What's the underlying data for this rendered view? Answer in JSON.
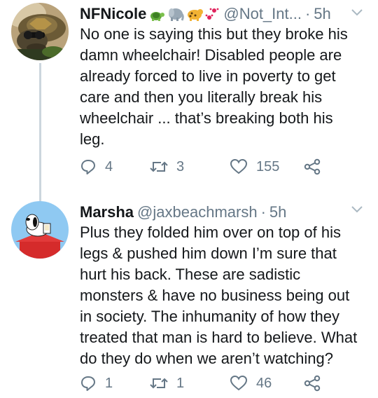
{
  "tweets": [
    {
      "author_name": "NFNicole",
      "author_emojis": [
        "turtle-emoji",
        "elephant-emoji",
        "leopard-emoji",
        "paw-prints-emoji"
      ],
      "handle": "@Not_Int...",
      "separator": "·",
      "time": "5h",
      "body_lines": [
        "No one is saying this but they broke his",
        "damn wheelchair! Disabled people are",
        "already forced to live in poverty to get",
        "care and then you literally break his",
        "wheelchair ... that’s breaking both his",
        "leg."
      ],
      "reply_count": "4",
      "retweet_count": "3",
      "like_count": "155"
    },
    {
      "author_name": "Marsha",
      "handle": "@jaxbeachmarsh",
      "separator": "·",
      "time": "5h",
      "body_lines": [
        "Plus they folded him over on top of his",
        "legs & pushed him down  I’m sure that",
        "hurt his back. These are sadistic",
        "monsters & have no business being out",
        "in society.  The inhumanity of how they",
        "treated that man is hard to believe. What",
        "do they do when we aren’t watching?"
      ],
      "reply_count": "1",
      "retweet_count": "1",
      "like_count": "46"
    }
  ],
  "colors": {
    "text": "#14171a",
    "secondary": "#657786",
    "thread_line": "#ccd6dd"
  }
}
